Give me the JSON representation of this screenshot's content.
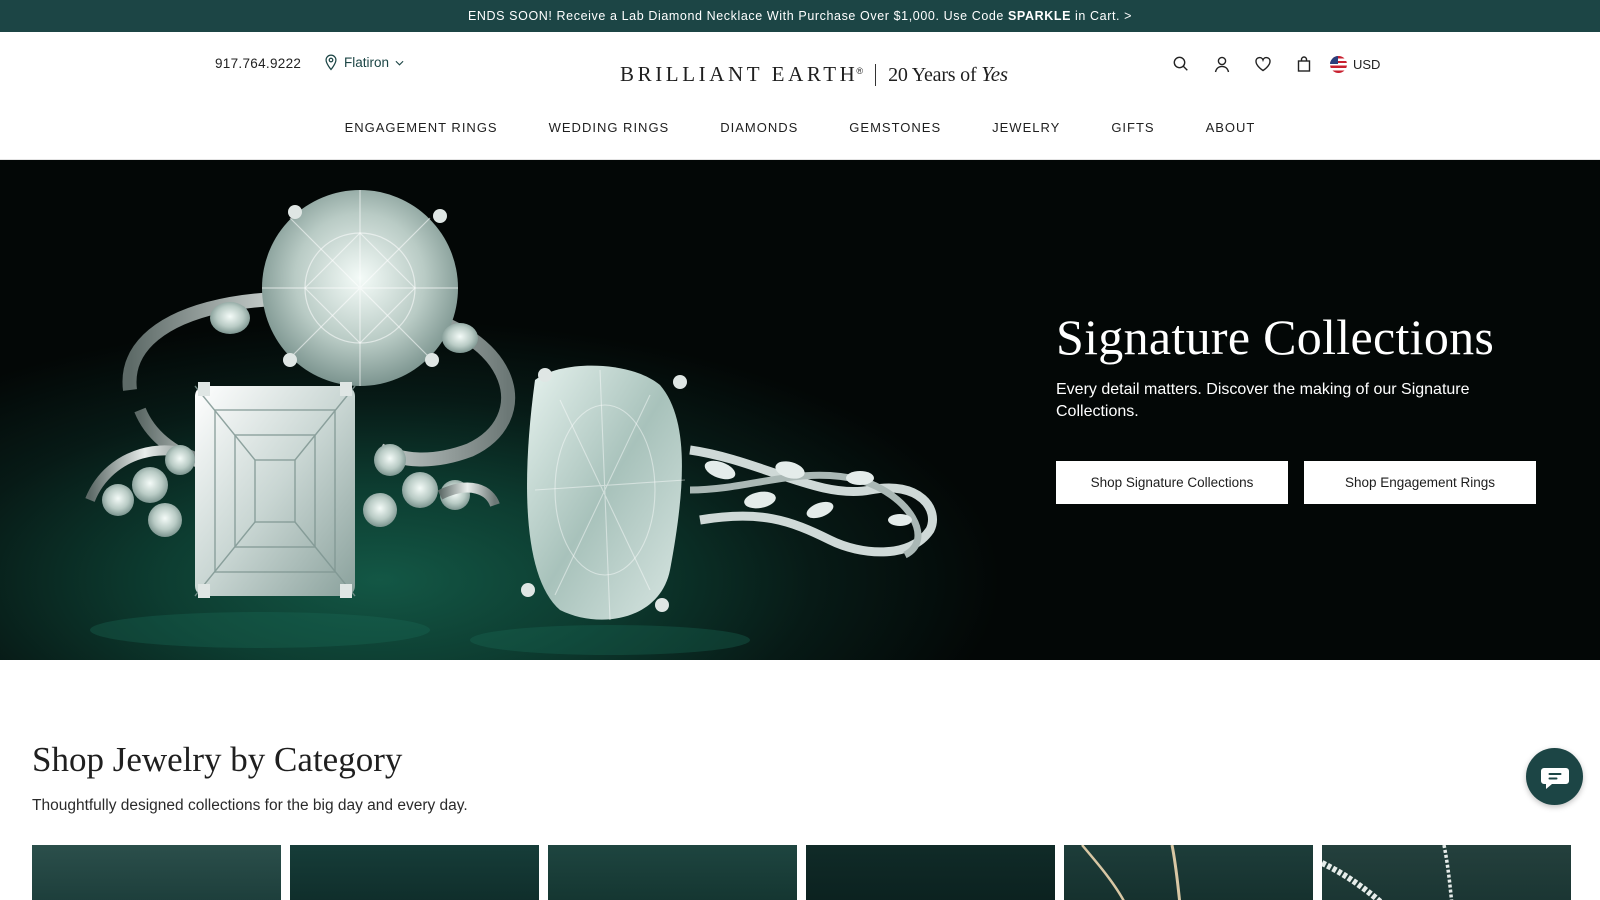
{
  "promo": {
    "text_before": "ENDS SOON! Receive a Lab Diamond Necklace With Purchase Over $1,000. Use Code",
    "code": "SPARKLE",
    "text_after": "in Cart.",
    "chevron": ">"
  },
  "header": {
    "phone": "917.764.9222",
    "location": "Flatiron",
    "logo_word": "BRILLIANT EARTH",
    "logo_mark": "®",
    "tagline_prefix": "20 Years of",
    "tagline_script": "Yes",
    "currency": "USD",
    "icons": [
      "search-icon",
      "account-icon",
      "wishlist-heart-icon",
      "shopping-bag-icon",
      "us-flag-icon"
    ]
  },
  "nav": {
    "items": [
      "ENGAGEMENT RINGS",
      "WEDDING RINGS",
      "DIAMONDS",
      "GEMSTONES",
      "JEWELRY",
      "GIFTS",
      "ABOUT"
    ]
  },
  "hero": {
    "title": "Signature Collections",
    "subtitle": "Every detail matters. Discover the making of our Signature Collections.",
    "buttons": [
      "Shop Signature Collections",
      "Shop Engagement Rings"
    ]
  },
  "category": {
    "title": "Shop Jewelry by Category",
    "subtitle": "Thoughtfully designed collections for the big day and every day."
  },
  "colors": {
    "brand_green": "#1c4545",
    "hero_background": "#071a16",
    "text": "#1d1d1d"
  }
}
